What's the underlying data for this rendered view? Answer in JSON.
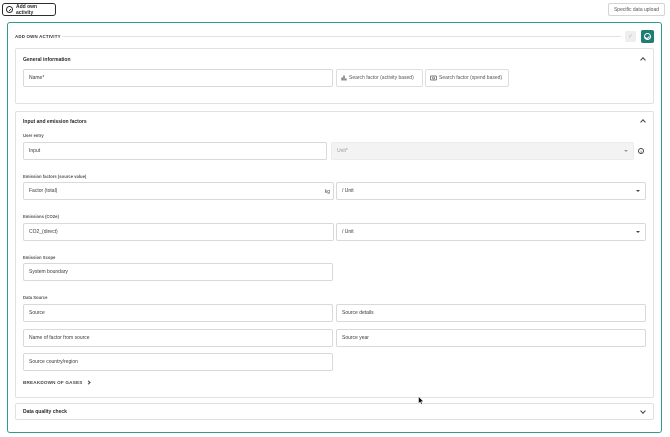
{
  "toolbar": {
    "add_activity_label": "Add own activity",
    "upload_label": "Specific data upload"
  },
  "panel": {
    "title": "ADD OWN ACTIVITY",
    "confirm_glyph": "✓"
  },
  "general": {
    "title": "General information",
    "name_placeholder": "Name*",
    "search_activity_label": "Search factor (activity based)",
    "search_spend_label": "Search factor (spend based)"
  },
  "factors": {
    "title": "Input and emission factors",
    "user_entry_label": "User entry",
    "input_placeholder": "Input",
    "unit_placeholder": "Unit*",
    "info_glyph": "i",
    "emission_factors_label": "Emission factors (source value)",
    "factor_total_placeholder": "Factor (total)",
    "factor_unit": "kg",
    "per_unit_1": "/ Unit",
    "emissions_label": "Emissions (CO2e)",
    "co2_direct_placeholder": "CO2_(direct)",
    "per_unit_2": "/ Unit",
    "scope_label": "Emission Scope",
    "system_boundary_placeholder": "System boundary",
    "data_source_label": "Data Source",
    "source_placeholder": "Source",
    "source_details_placeholder": "Source details",
    "factor_name_placeholder": "Name of factor from source",
    "source_year_placeholder": "Source year",
    "source_region_placeholder": "Source country/region",
    "breakdown_label": "BREAKDOWN OF GASES"
  },
  "quality": {
    "title": "Data quality check"
  },
  "colors": {
    "accent": "#2e9c8a",
    "primary_button": "#1f7e73"
  }
}
